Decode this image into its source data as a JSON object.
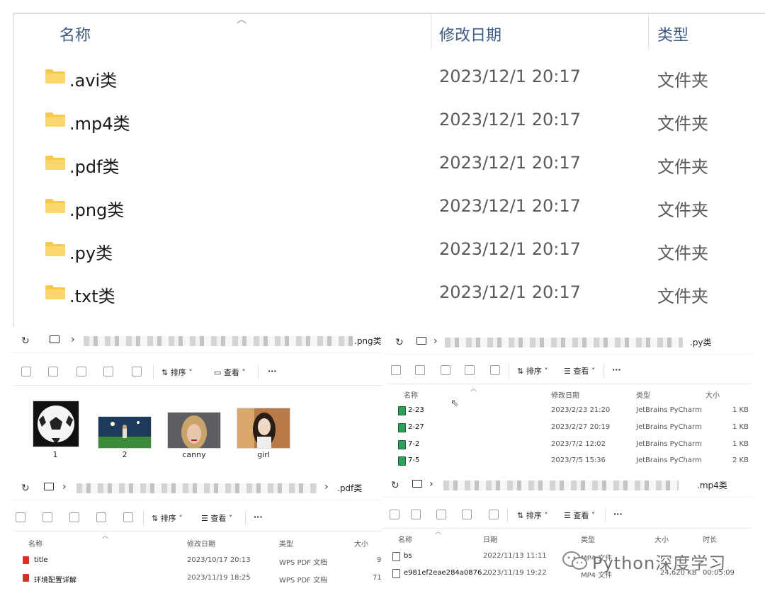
{
  "main": {
    "headers": {
      "name": "名称",
      "date": "修改日期",
      "type": "类型"
    },
    "rows": [
      {
        "name": ".avi类",
        "date": "2023/12/1 20:17",
        "type": "文件夹"
      },
      {
        "name": ".mp4类",
        "date": "2023/12/1 20:17",
        "type": "文件夹"
      },
      {
        "name": ".pdf类",
        "date": "2023/12/1 20:17",
        "type": "文件夹"
      },
      {
        "name": ".png类",
        "date": "2023/12/1 20:17",
        "type": "文件夹"
      },
      {
        "name": ".py类",
        "date": "2023/12/1 20:17",
        "type": "文件夹"
      },
      {
        "name": ".txt类",
        "date": "2023/12/1 20:17",
        "type": "文件夹"
      }
    ]
  },
  "toolbar": {
    "sort": "排序",
    "view": "查看",
    "more": "···"
  },
  "png_pane": {
    "crumb": ".png类",
    "items": [
      {
        "label": "1"
      },
      {
        "label": "2"
      },
      {
        "label": "canny"
      },
      {
        "label": "girl"
      }
    ]
  },
  "py_pane": {
    "crumb": ".py类",
    "headers": {
      "name": "名称",
      "date": "修改日期",
      "type": "类型",
      "size": "大小"
    },
    "rows": [
      {
        "name": "2-23",
        "date": "2023/2/23 21:20",
        "type": "JetBrains PyCharm",
        "size": "1 KB"
      },
      {
        "name": "2-27",
        "date": "2023/2/27 20:19",
        "type": "JetBrains PyCharm",
        "size": "1 KB"
      },
      {
        "name": "7-2",
        "date": "2023/7/2 12:02",
        "type": "JetBrains PyCharm",
        "size": "1 KB"
      },
      {
        "name": "7-5",
        "date": "2023/7/5 15:36",
        "type": "JetBrains PyCharm",
        "size": "2 KB"
      }
    ]
  },
  "pdf_pane": {
    "crumb": ".pdf类",
    "headers": {
      "name": "名称",
      "date": "修改日期",
      "type": "类型",
      "size": "大小"
    },
    "rows": [
      {
        "name": "title",
        "date": "2023/10/17 20:13",
        "type": "WPS PDF 文档",
        "size": "9"
      },
      {
        "name": "环境配置详解",
        "date": "2023/11/19 18:25",
        "type": "WPS PDF 文档",
        "size": "71"
      }
    ]
  },
  "mp4_pane": {
    "crumb": ".mp4类",
    "headers": {
      "name": "名称",
      "date": "日期",
      "type": "类型",
      "size": "大小",
      "duration": "时长"
    },
    "rows": [
      {
        "name": "bs",
        "date": "2022/11/13 11:11",
        "type": "MP4 文件",
        "size": "",
        "duration": ""
      },
      {
        "name": "e981ef2eae284a0876...",
        "date": "2023/11/19 19:22",
        "type": "MP4 文件",
        "size": "24,620 KB",
        "duration": "00:05:09"
      }
    ]
  },
  "watermark": {
    "text": "Python深度学习"
  },
  "colors": {
    "folder": "#f7c948",
    "header_text": "#3d5a80",
    "png_icon": "#2f9e5a",
    "pdf_icon": "#d93025"
  }
}
